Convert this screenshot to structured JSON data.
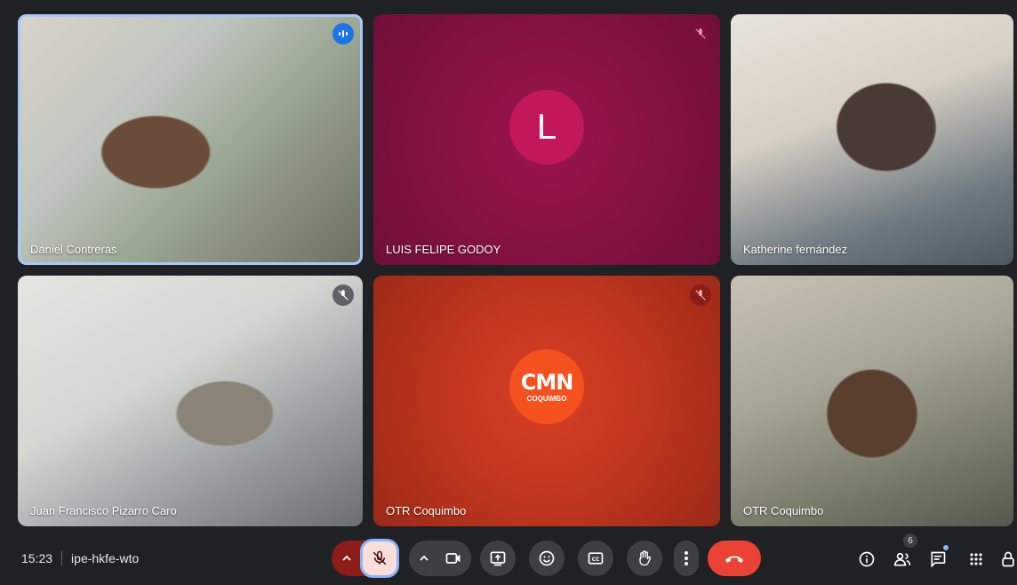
{
  "participants": [
    {
      "name": "Daniel Contreras"
    },
    {
      "name": "LUIS FELIPE GODOY",
      "avatar_letter": "L"
    },
    {
      "name": "Katherine fernández"
    },
    {
      "name": "Juan Francisco Pizarro Caro"
    },
    {
      "name": "OTR Coquimbo",
      "logo_text": "CMN",
      "logo_subtext": "COQUIMBO"
    },
    {
      "name": "OTR Coquimbo"
    }
  ],
  "meeting": {
    "time": "15:23",
    "code": "ipe-hkfe-wto"
  },
  "people_count": "6",
  "colors": {
    "speaking_outline": "#a8c7fa",
    "end_call": "#ea4335",
    "mic_muted_bg": "#f9dedc",
    "avatar_L": "#c2185b",
    "cmn_logo": "#f4511e"
  },
  "icons": [
    "speaking-icon",
    "mic-off-icon",
    "chevron-up-icon",
    "camera-icon",
    "present-icon",
    "emoji-icon",
    "captions-icon",
    "raise-hand-icon",
    "more-icon",
    "end-call-icon",
    "info-icon",
    "people-icon",
    "chat-icon",
    "apps-icon",
    "lock-icon"
  ]
}
